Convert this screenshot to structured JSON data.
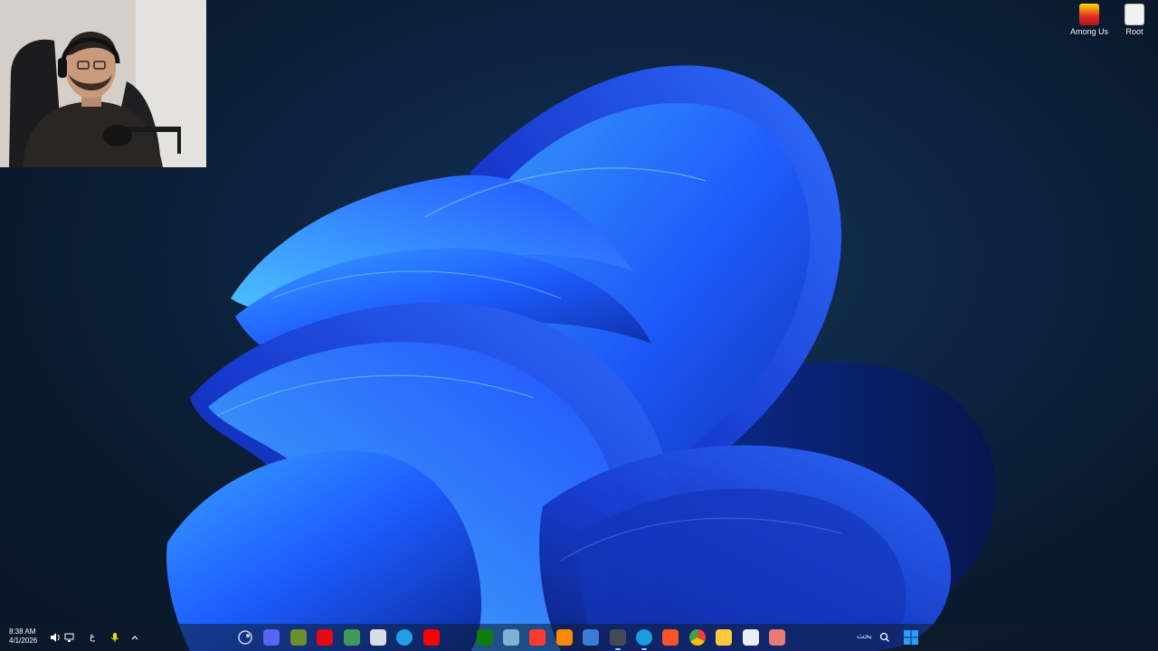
{
  "desktop": {
    "icons": [
      {
        "label": "Among Us",
        "icon": "among-us-icon"
      },
      {
        "label": "Root",
        "icon": "root-icon"
      }
    ]
  },
  "taskbar": {
    "clock": {
      "time": "8:38 AM",
      "date": "4/1/2026"
    },
    "tray": {
      "language_indicator": "ع",
      "icons": [
        "speaker-icon",
        "network-icon",
        "microphone-icon",
        "chevron-up-icon"
      ]
    },
    "apps": [
      {
        "name": "steam-icon",
        "color": "#c7d5e0"
      },
      {
        "name": "discord-icon",
        "color": "#5865f2"
      },
      {
        "name": "archive-icon",
        "color": "#6b8f2a"
      },
      {
        "name": "netflix-icon",
        "color": "#e50914"
      },
      {
        "name": "game-launcher-icon",
        "color": "#3f9a5a"
      },
      {
        "name": "settings-gear-icon",
        "color": "#d8dde6"
      },
      {
        "name": "edge-icon",
        "color": "#1fa0e3"
      },
      {
        "name": "youtube-icon",
        "color": "#ff0000"
      },
      {
        "name": "zoom-icon",
        "color": "#ffffff"
      },
      {
        "name": "xbox-icon",
        "color": "#107c10"
      },
      {
        "name": "steam-alt-icon",
        "color": "#7fb2d6"
      },
      {
        "name": "opera-icon",
        "color": "#ff3b30"
      },
      {
        "name": "vlc-icon",
        "color": "#ff8800"
      },
      {
        "name": "store-icon",
        "color": "#3a7bd5"
      },
      {
        "name": "clock-app-icon",
        "color": "#444a55"
      },
      {
        "name": "edge-browser-icon",
        "color": "#1b9be0"
      },
      {
        "name": "brave-icon",
        "color": "#fb542b"
      },
      {
        "name": "chrome-icon",
        "color": "#f4b400"
      },
      {
        "name": "file-explorer-icon",
        "color": "#ffc83d"
      },
      {
        "name": "notepad-icon",
        "color": "#e8eef6"
      },
      {
        "name": "widgets-icon",
        "color": "#e67c73"
      }
    ],
    "search": {
      "label": "بحث"
    },
    "start_icon": "windows-start-icon",
    "accent": "#2a7fff"
  }
}
